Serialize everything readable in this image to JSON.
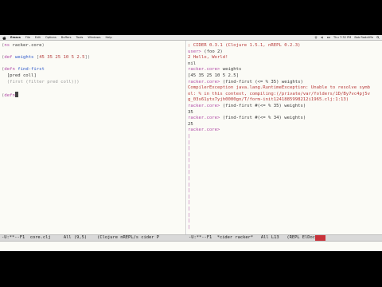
{
  "menubar": {
    "app": "Emacs",
    "items": [
      "File",
      "Edit",
      "Options",
      "Buffers",
      "Tools",
      "Windows",
      "Help"
    ],
    "status": [
      "Thu 7:32 PM",
      "Bob Radcliffe"
    ]
  },
  "left_buffer": {
    "lines": [
      [
        {
          "t": "(",
          "c": "br"
        },
        {
          "t": "ns",
          "c": "kw"
        },
        {
          "t": " racker.core",
          "c": "plain"
        },
        {
          "t": ")",
          "c": "br"
        }
      ],
      [],
      [
        {
          "t": "(",
          "c": "br"
        },
        {
          "t": "def",
          "c": "kw"
        },
        {
          "t": " weights",
          "c": "fn"
        },
        {
          "t": " [",
          "c": "br"
        },
        {
          "t": "45 35 25 10 5 2.5",
          "c": "num"
        },
        {
          "t": "])",
          "c": "br"
        }
      ],
      [],
      [
        {
          "t": "(",
          "c": "br"
        },
        {
          "t": "defn",
          "c": "kw"
        },
        {
          "t": " find-first",
          "c": "fn"
        }
      ],
      [
        {
          "t": "  [pred coll]",
          "c": "plain"
        }
      ],
      [
        {
          "t": "  (first (filter pred coll)))",
          "c": "muted"
        }
      ],
      [],
      [
        {
          "t": "(",
          "c": "br"
        },
        {
          "t": "defn",
          "c": "kw"
        },
        {
          "t": "CURSOR",
          "c": "cursor"
        }
      ]
    ]
  },
  "right_buffer": {
    "lines": [
      [
        {
          "t": "; CIDER 0.3.1 (Clojure 1.5.1, nREPL 0.2.3)",
          "c": "err"
        }
      ],
      [
        {
          "t": "user> ",
          "c": "prompt"
        },
        {
          "t": "(foo 2)",
          "c": "plain"
        }
      ],
      [
        {
          "t": "2 Hello, World!",
          "c": "err"
        }
      ],
      [
        {
          "t": "nil",
          "c": "plain"
        }
      ],
      [
        {
          "t": "racker.core> ",
          "c": "prompt"
        },
        {
          "t": "weights",
          "c": "plain"
        }
      ],
      [
        {
          "t": "[45 35 25 10 5 2.5]",
          "c": "plain"
        }
      ],
      [
        {
          "t": "racker.core> ",
          "c": "prompt"
        },
        {
          "t": "(find-first (<= % 35) weights)",
          "c": "plain"
        }
      ],
      [
        {
          "t": "CompilerException java.lang.RuntimeException: Unable to resolve symb",
          "c": "err"
        }
      ],
      [
        {
          "t": "ol: % in this context, compiling:(/private/var/folders/1D/By7vc4pj5v",
          "c": "err"
        }
      ],
      [
        {
          "t": "g_03s61ytx7yjh0000gn/T/form-init1241885998212i1965.clj:1:13)",
          "c": "err"
        }
      ],
      [
        {
          "t": "racker.core> ",
          "c": "prompt"
        },
        {
          "t": "(find-first #(<= % 35) weights)",
          "c": "plain"
        }
      ],
      [
        {
          "t": "35",
          "c": "plain"
        }
      ],
      [
        {
          "t": "racker.core> ",
          "c": "prompt"
        },
        {
          "t": "(find-first #(<= % 34) weights)",
          "c": "plain"
        }
      ],
      [
        {
          "t": "25",
          "c": "plain"
        }
      ],
      [
        {
          "t": "racker.core> ",
          "c": "prompt"
        }
      ]
    ],
    "fringe_count": 16,
    "fringe_char": "|"
  },
  "modeline": {
    "left": "-U:**--F1  core.clj     All (9,5)    (Clojure nREPL/s cider P",
    "right": "-U:**--F1  *cider racker*   All L13   (REPL ElDoc"
  }
}
